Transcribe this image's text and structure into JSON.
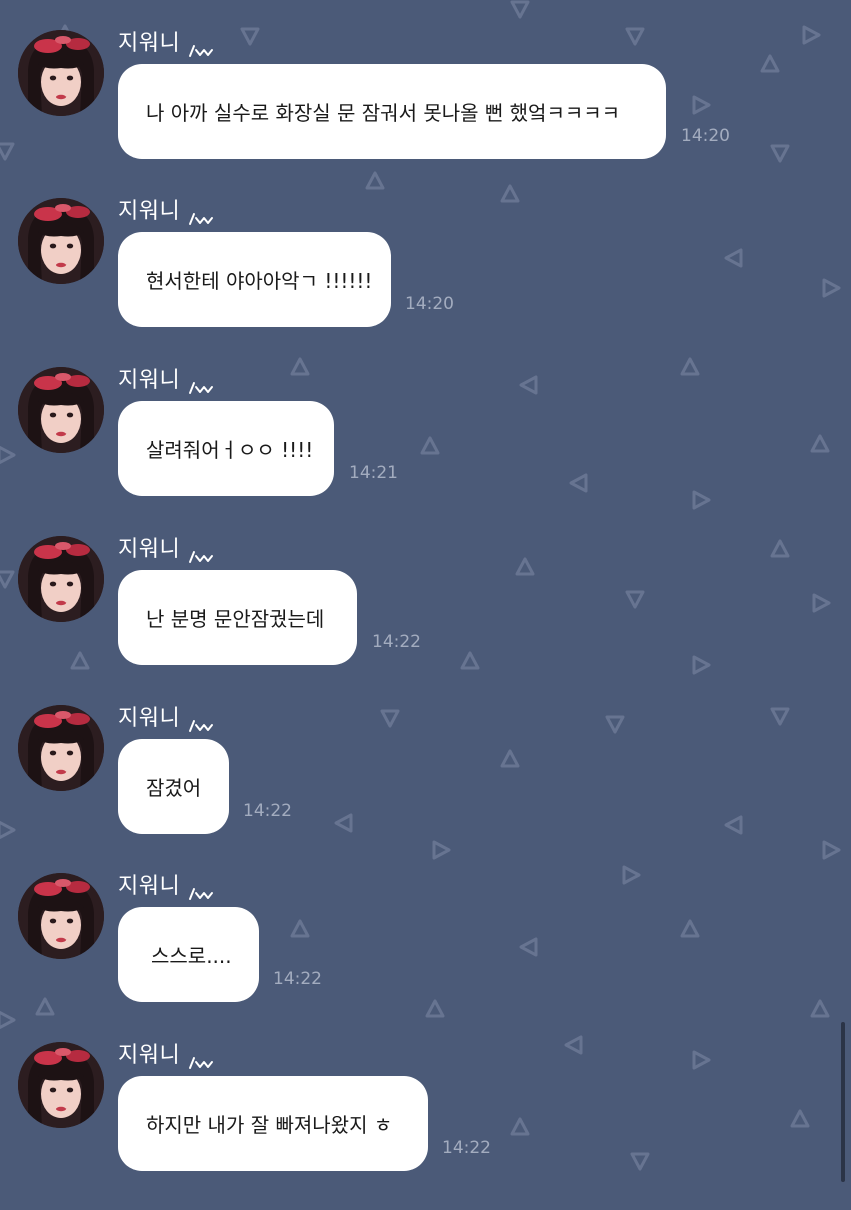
{
  "sender": {
    "name": "지워니"
  },
  "messages": [
    {
      "text": "나 아까 실수로 화장실 문 잠궈서 못나올 뻔 했엌ㅋㅋㅋㅋ",
      "time": "14:20"
    },
    {
      "text": "현서한테 야아아악ㄱ !!!!!!",
      "time": "14:20"
    },
    {
      "text": "살려줘어ㅓㅇㅇ !!!!",
      "time": "14:21"
    },
    {
      "text": "난 분명 문안잠궜는데",
      "time": "14:22"
    },
    {
      "text": "잠겼어",
      "time": "14:22"
    },
    {
      "text": "스스로....",
      "time": "14:22"
    },
    {
      "text": "하지만 내가 잘 빠져나왔지 ㅎ",
      "time": "14:22"
    }
  ],
  "icons": {
    "badge": "status-badge-icon",
    "avatar": "profile-photo"
  },
  "colors": {
    "background": "#4b5a78",
    "bubble": "#ffffff",
    "timestamp": "#a3acbf",
    "pattern": "#7f8ba5"
  }
}
